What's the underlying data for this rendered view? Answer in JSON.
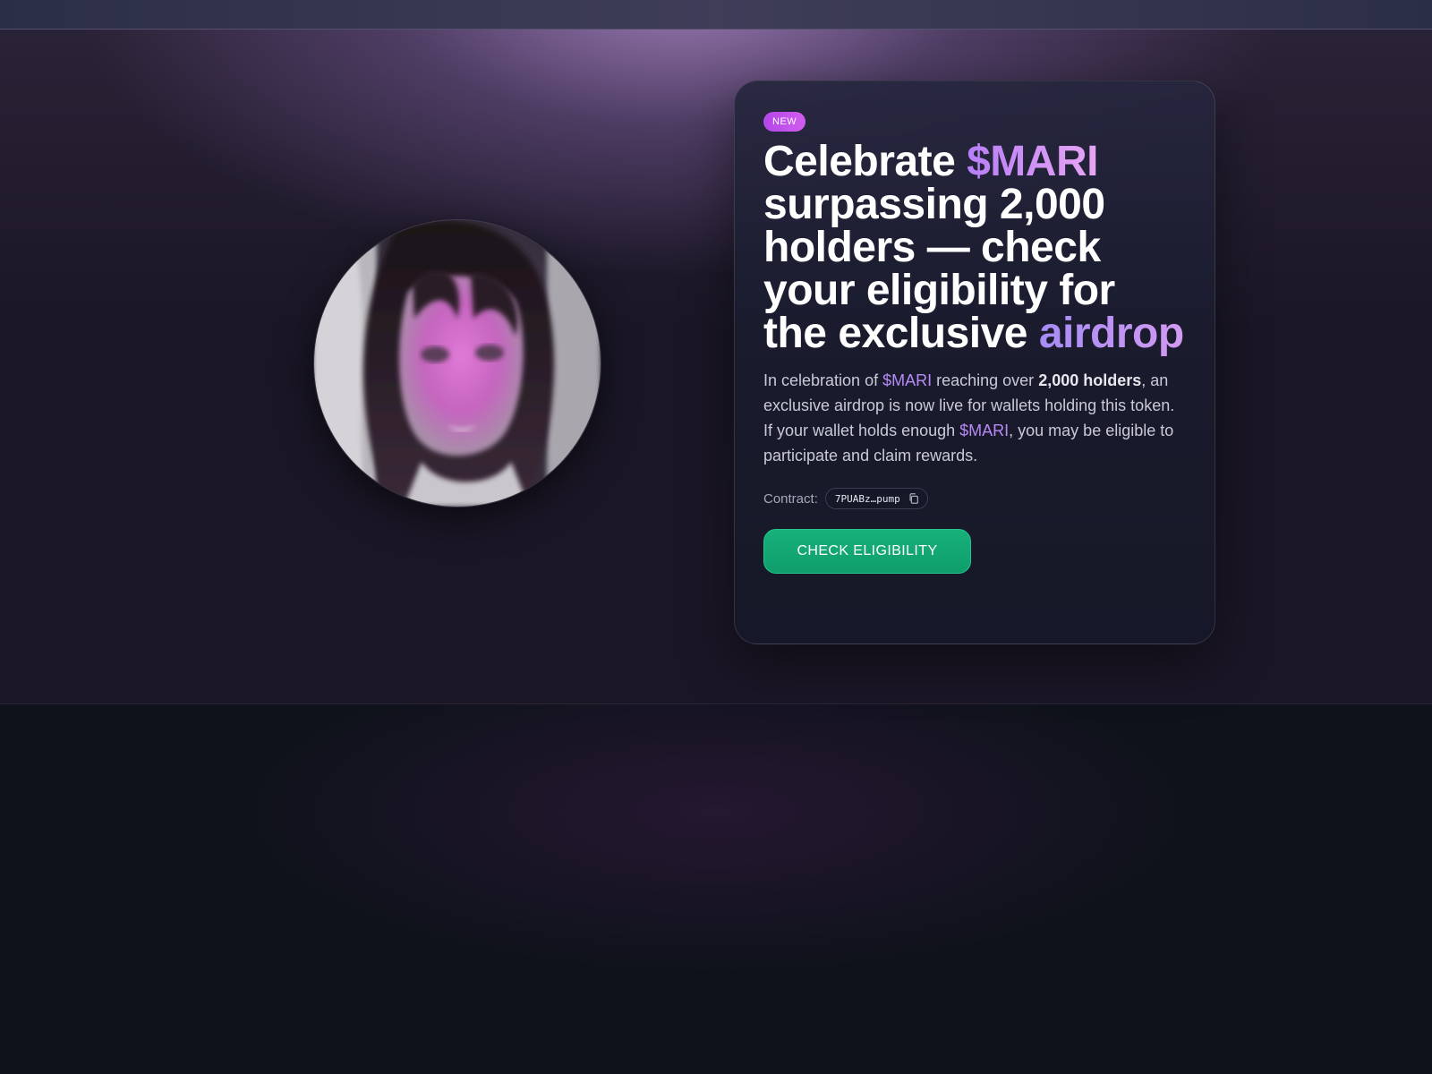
{
  "badge": "NEW",
  "headline": {
    "part1": "Celebrate ",
    "ticker": "$MARI",
    "part2": " surpassing 2,000 holders — check your eligibility for the exclusive ",
    "accent_end": "airdrop"
  },
  "description": {
    "t1": "In celebration of ",
    "ticker1": "$MARI",
    "t2": " reaching over ",
    "bold": "2,000 holders",
    "t3": ", an exclusive airdrop is now live for wallets holding this token. If your wallet holds enough ",
    "ticker2": "$MARI",
    "t4": ", you may be eligible to participate and claim rewards."
  },
  "contract": {
    "label": "Contract:",
    "address": "7PUABz…pump"
  },
  "cta_label": "CHECK ELIGIBILITY",
  "icons": {
    "copy": "copy-icon",
    "avatar": "avatar-image"
  },
  "colors": {
    "accent": "#b77ef7",
    "button": "#12a874",
    "badge": "#c251ec",
    "background": "#0f121b"
  }
}
